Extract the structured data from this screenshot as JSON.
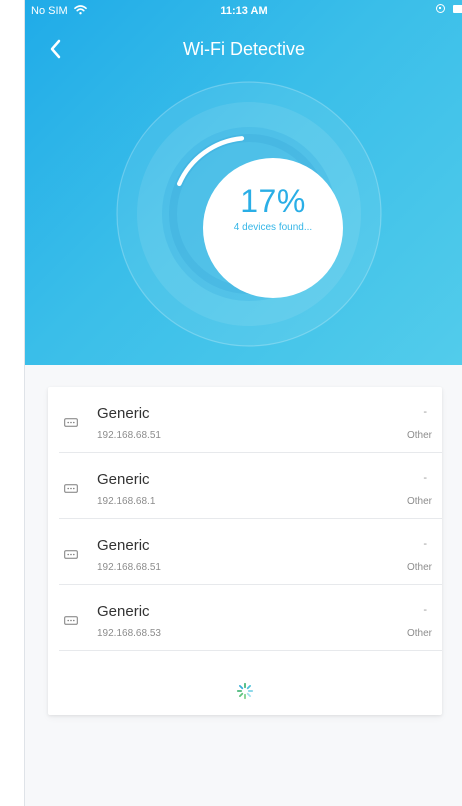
{
  "status_bar": {
    "carrier": "No SIM",
    "time": "11:13 AM"
  },
  "header": {
    "title": "Wi-Fi Detective",
    "back_icon": "chevron-left-icon"
  },
  "scan": {
    "progress_percent": 17,
    "percent_label": "17%",
    "devices_found_label": "4 devices found..."
  },
  "devices": [
    {
      "name": "Generic",
      "ip": "192.168.68.51",
      "signal": "-",
      "type": "Other",
      "icon": "device-dots-icon"
    },
    {
      "name": "Generic",
      "ip": "192.168.68.1",
      "signal": "-",
      "type": "Other",
      "icon": "device-dots-icon"
    },
    {
      "name": "Generic",
      "ip": "192.168.68.51",
      "signal": "-",
      "type": "Other",
      "icon": "device-dots-icon"
    },
    {
      "name": "Generic",
      "ip": "192.168.68.53",
      "signal": "-",
      "type": "Other",
      "icon": "device-dots-icon"
    }
  ],
  "loading": {
    "icon": "loading-spinner-icon"
  },
  "colors": {
    "header_start": "#20abe8",
    "header_end": "#52cceb",
    "accent": "#2aaee6",
    "text_secondary": "#8c8c8c"
  }
}
